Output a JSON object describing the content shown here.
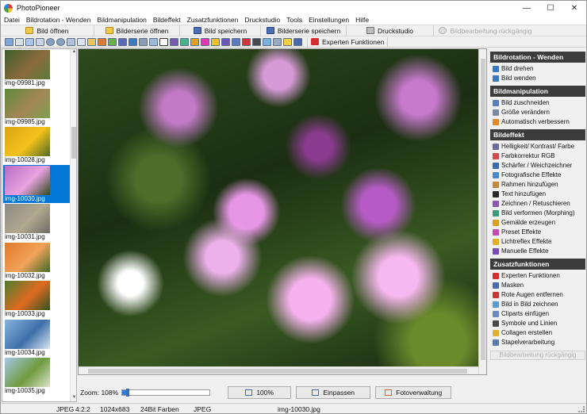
{
  "window": {
    "title": "PhotoPioneer",
    "controls": [
      "—",
      "☐",
      "✕"
    ]
  },
  "menu": [
    "Datei",
    "Bildrotation - Wenden",
    "Bildmanipulation",
    "Bildeffekt",
    "Zusatzfunktionen",
    "Druckstudio",
    "Tools",
    "Einstellungen",
    "Hilfe"
  ],
  "toolbar": {
    "open_image": "Bild öffnen",
    "open_series": "Bilderserie öffnen",
    "save_image": "Bild speichern",
    "save_series": "Bilderserie speichern",
    "print_studio": "Druckstudio",
    "undo": "Bildbearbeitung rückgängig",
    "expert": "Experten Funktionen"
  },
  "thumbnails": [
    {
      "label": "img-09981.jpg",
      "colors": [
        "#3e5c2b",
        "#8a6b3d",
        "#5d7a3a"
      ],
      "selected": false
    },
    {
      "label": "img-09985.jpg",
      "colors": [
        "#5d8a3a",
        "#a28655",
        "#7ea050"
      ],
      "selected": false
    },
    {
      "label": "img-10028.jpg",
      "colors": [
        "#d9a314",
        "#f4c21c",
        "#4f6a22"
      ],
      "selected": false
    },
    {
      "label": "img-10030.jpg",
      "colors": [
        "#b76cc2",
        "#e8a3e0",
        "#2e4a1c"
      ],
      "selected": true
    },
    {
      "label": "img-10031.jpg",
      "colors": [
        "#8a8a86",
        "#b2a88f",
        "#6d6b64"
      ],
      "selected": false
    },
    {
      "label": "img-10032.jpg",
      "colors": [
        "#e07a2a",
        "#f2a25a",
        "#3f6a26"
      ],
      "selected": false
    },
    {
      "label": "img-10033.jpg",
      "colors": [
        "#4d7d2e",
        "#e06a20",
        "#2f5420"
      ],
      "selected": false
    },
    {
      "label": "img-10034.jpg",
      "colors": [
        "#86b5e0",
        "#3f6fa8",
        "#d8e6f2"
      ],
      "selected": false
    },
    {
      "label": "img-10035.jpg",
      "colors": [
        "#a4c8e6",
        "#6f9a3e",
        "#d9e2c8"
      ],
      "selected": false
    }
  ],
  "zoom": {
    "label": "Zoom: 108%",
    "level": 0.04,
    "btn_100": "100%",
    "btn_fit": "Einpassen",
    "btn_manager": "Fotoverwaltung"
  },
  "panel": {
    "sections": [
      {
        "title": "Bildrotation - Wenden",
        "items": [
          {
            "label": "Bild drehen",
            "color": "#3b78c4"
          },
          {
            "label": "Bild wenden",
            "color": "#3b78c4"
          }
        ]
      },
      {
        "title": "Bildmanipulation",
        "items": [
          {
            "label": "Bild zuschneiden",
            "color": "#5a7fb8"
          },
          {
            "label": "Größe verändern",
            "color": "#7a8aa0"
          },
          {
            "label": "Automatisch verbessern",
            "color": "#e08a2a"
          }
        ]
      },
      {
        "title": "Bildeffekt",
        "items": [
          {
            "label": "Helligkeit/ Kontrast/ Farbe",
            "color": "#6b6b9e"
          },
          {
            "label": "Farbkorrektur RGB",
            "color": "#d24a4a"
          },
          {
            "label": "Schärfer / Weichzeichner",
            "color": "#3a6ab0"
          },
          {
            "label": "Fotografische Effekte",
            "color": "#4a8ac8"
          },
          {
            "label": "Rahmen hinzufügen",
            "color": "#c08a3a"
          },
          {
            "label": "Text hinzufügen",
            "color": "#2a2a2a"
          },
          {
            "label": "Zeichnen / Retuschieren",
            "color": "#8a5ab0"
          },
          {
            "label": "Bild verformen (Morphing)",
            "color": "#3a9a7a"
          },
          {
            "label": "Gemälde erzeugen",
            "color": "#d8a020"
          },
          {
            "label": "Preset Effekte",
            "color": "#c84ab0"
          },
          {
            "label": "Lichtreflex Effekte",
            "color": "#e0b020"
          },
          {
            "label": "Manuelle Effekte",
            "color": "#7a4ab8"
          }
        ]
      },
      {
        "title": "Zusatzfunktionen",
        "items": [
          {
            "label": "Experten Funktionen",
            "color": "#d32f2f"
          },
          {
            "label": "Masken",
            "color": "#4a6ab0"
          },
          {
            "label": "Rote Augen entfernen",
            "color": "#c83a3a"
          },
          {
            "label": "Bild in Bild zeichnen",
            "color": "#5a9ad0"
          },
          {
            "label": "Cliparts einfügen",
            "color": "#6a8ac0"
          },
          {
            "label": "Symbole und Linien",
            "color": "#4a4a4a"
          },
          {
            "label": "Collagen erstellen",
            "color": "#e0b030"
          },
          {
            "label": "Stapelverarbeitung",
            "color": "#5a7ab0"
          }
        ]
      }
    ],
    "undo_disabled": "Bildbearbeitung rückgängig"
  },
  "status": {
    "format": "JPEG",
    "subsampling": "4:2:2",
    "dimensions": "1024x683",
    "colors": "24Bit Farben",
    "type": "JPEG",
    "filename": "img-10030.jpg"
  }
}
